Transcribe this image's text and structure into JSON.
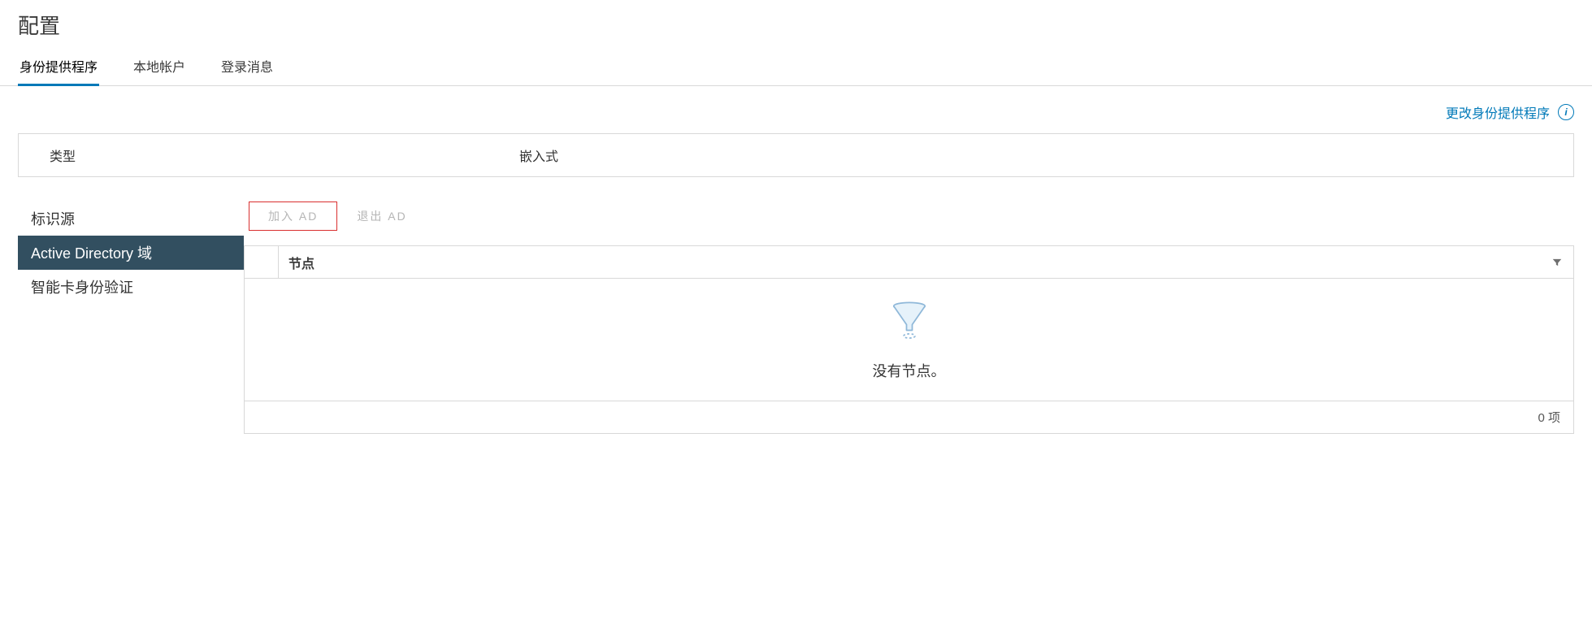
{
  "page_title": "配置",
  "tabs": {
    "identity_provider": "身份提供程序",
    "local_accounts": "本地帐户",
    "login_message": "登录消息"
  },
  "actions": {
    "change_identity_provider": "更改身份提供程序"
  },
  "type_row": {
    "label": "类型",
    "value": "嵌入式"
  },
  "sidebar": {
    "identity_sources": "标识源",
    "active_directory_domain": "Active Directory 域",
    "smart_card_auth": "智能卡身份验证"
  },
  "ad_actions": {
    "join": "加入 AD",
    "leave": "退出 AD"
  },
  "grid": {
    "column_node": "节点",
    "empty_message": "没有节点。",
    "footer_count": "0 项"
  }
}
